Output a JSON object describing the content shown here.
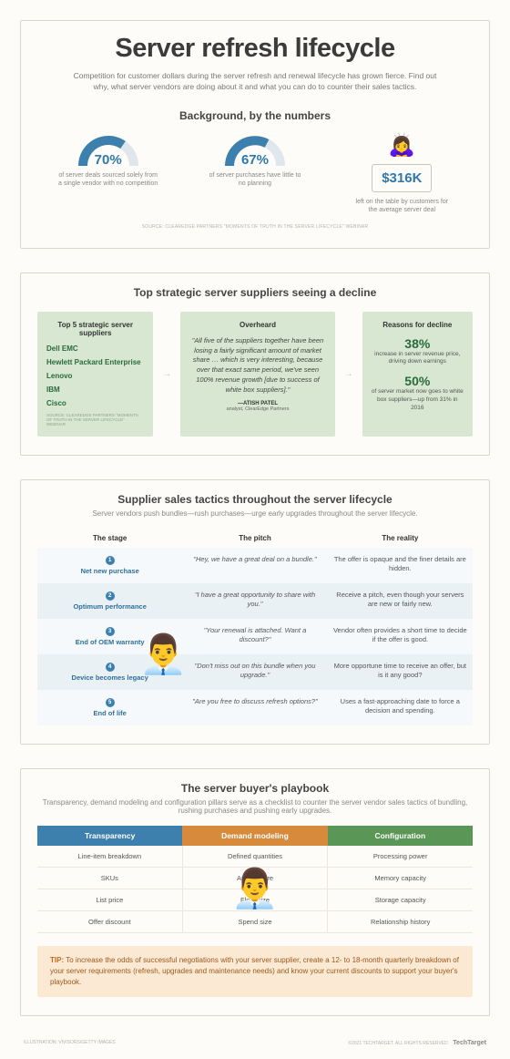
{
  "title": "Server refresh lifecycle",
  "subtitle": "Competition for customer dollars during the server refresh and renewal lifecycle has grown fierce. Find out why, what server vendors are doing about it and what you can do to counter their sales tactics.",
  "background": {
    "heading": "Background, by the numbers",
    "items": [
      {
        "value": "70%",
        "desc": "of server deals sourced solely from a single vendor with no competition"
      },
      {
        "value": "67%",
        "desc": "of server purchases have little to no planning"
      },
      {
        "value": "$316K",
        "desc": "left on the table by customers for the average server deal"
      }
    ],
    "source": "SOURCE: CLEAREDGE PARTNERS \"MOMENTS OF TRUTH IN THE SERVER LIFECYCLE\" WEBINAR"
  },
  "decline": {
    "heading": "Top strategic server suppliers seeing a decline",
    "suppliers_title": "Top 5 strategic server suppliers",
    "suppliers": [
      "Dell EMC",
      "Hewlett Packard Enterprise",
      "Lenovo",
      "IBM",
      "Cisco"
    ],
    "suppliers_source": "SOURCE: CLEAREDGE PARTNERS \"MOMENTS OF TRUTH IN THE SERVER LIFECYCLE\" WEBINAR",
    "overheard_title": "Overheard",
    "quote": "\"All five of the suppliers together have been losing a fairly significant amount of market share … which is very interesting, because over that exact same period, we've seen 100% revenue growth [due to success of white box suppliers].\"",
    "attrib_name": "—ATISH PATEL",
    "attrib_role": "analyst, ClearEdge Partners",
    "reasons_title": "Reasons for decline",
    "reasons": [
      {
        "pct": "38%",
        "desc": "increase in server revenue price, driving down earnings"
      },
      {
        "pct": "50%",
        "desc": "of server market now goes to white box suppliers—up from 31% in 2016"
      }
    ]
  },
  "lifecycle": {
    "heading": "Supplier sales tactics throughout the server lifecycle",
    "sub": "Server vendors push bundles—rush purchases—urge early upgrades throughout the server lifecycle.",
    "cols": [
      "The stage",
      "The pitch",
      "The reality"
    ],
    "rows": [
      {
        "n": "1",
        "stage": "Net new purchase",
        "pitch": "\"Hey, we have a great deal on a bundle.\"",
        "reality": "The offer is opaque and the finer details are hidden."
      },
      {
        "n": "2",
        "stage": "Optimum performance",
        "pitch": "\"I have a great opportunity to share with you.\"",
        "reality": "Receive a pitch, even though your servers are new or fairly new."
      },
      {
        "n": "3",
        "stage": "End of OEM warranty",
        "pitch": "\"Your renewal is attached. Want a discount?\"",
        "reality": "Vendor often provides a short time to decide if the offer is good."
      },
      {
        "n": "4",
        "stage": "Device becomes legacy",
        "pitch": "\"Don't miss out on this bundle when you upgrade.\"",
        "reality": "More opportune time to receive an offer, but is it any good?"
      },
      {
        "n": "5",
        "stage": "End of life",
        "pitch": "\"Are you free to discuss refresh options?\"",
        "reality": "Uses a fast-approaching date to force a decision and spending."
      }
    ]
  },
  "playbook": {
    "heading": "The server buyer's playbook",
    "sub": "Transparency, demand modeling and configuration pillars serve as a checklist to counter the server vendor sales tactics of bundling, rushing purchases and pushing early upgrades.",
    "cols": [
      "Transparency",
      "Demand modeling",
      "Configuration"
    ],
    "rows": [
      [
        "Line-item breakdown",
        "Defined quantities",
        "Processing power"
      ],
      [
        "SKUs",
        "Architecture",
        "Memory capacity"
      ],
      [
        "List price",
        "Fleet size",
        "Storage capacity"
      ],
      [
        "Offer discount",
        "Spend size",
        "Relationship history"
      ]
    ],
    "tip_label": "TIP:",
    "tip": "To increase the odds of successful negotiations with your server supplier, create a 12- to 18-month quarterly breakdown of your server requirements (refresh, upgrades and maintenance needs) and know your current discounts to support your buyer's playbook."
  },
  "footer_left": "ILLUSTRATION: VIVISORS/GETTY IMAGES",
  "footer_right_copy": "©2021 TECHTARGET. ALL RIGHTS RESERVED",
  "footer_brand": "TechTarget"
}
